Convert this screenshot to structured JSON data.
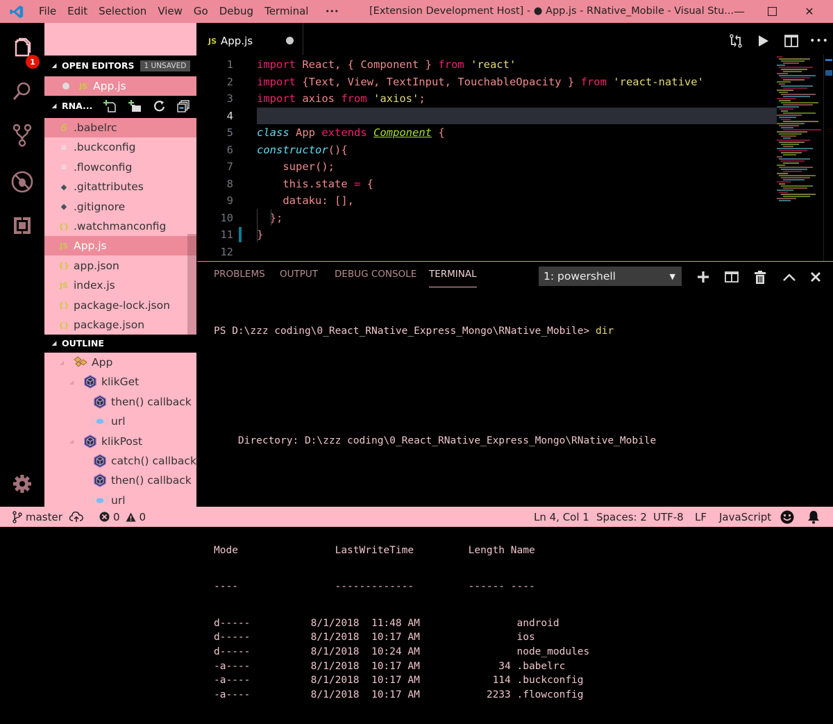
{
  "titlebar": {
    "menu": [
      "File",
      "Edit",
      "Selection",
      "View",
      "Go",
      "Debug",
      "Terminal",
      "•••"
    ],
    "title": "[Extension Development Host] - ● App.js - RNative_Mobile - Visual Stu...",
    "minimize": "—",
    "maximize": "☐",
    "close": "✕"
  },
  "activitybar": {
    "items": [
      "explorer-icon",
      "search-icon",
      "source-control-icon",
      "debug-icon",
      "extensions-icon"
    ],
    "explorer_badge": "1",
    "settings": "gear-icon"
  },
  "sidebar": {
    "open_editors": {
      "label": "OPEN EDITORS",
      "badge": "1 UNSAVED",
      "files": [
        {
          "icon": "JS",
          "name": "App.js",
          "dirty": true
        }
      ]
    },
    "folder": {
      "label": "RNA...",
      "actions": [
        "new-file-icon",
        "new-folder-icon",
        "refresh-icon",
        "collapse-all-icon"
      ],
      "files": [
        {
          "icon": "6",
          "name": ".babelrc",
          "type": "babel"
        },
        {
          "icon": "≡",
          "name": ".buckconfig",
          "type": "config"
        },
        {
          "icon": "≡",
          "name": ".flowconfig",
          "type": "config"
        },
        {
          "icon": "◆",
          "name": ".gitattributes",
          "type": "git"
        },
        {
          "icon": "◆",
          "name": ".gitignore",
          "type": "git"
        },
        {
          "icon": "{}",
          "name": ".watchmanconfig",
          "type": "json"
        },
        {
          "icon": "JS",
          "name": "App.js",
          "type": "js"
        },
        {
          "icon": "{}",
          "name": "app.json",
          "type": "json"
        },
        {
          "icon": "JS",
          "name": "index.js",
          "type": "js"
        },
        {
          "icon": "{}",
          "name": "package-lock.json",
          "type": "json"
        },
        {
          "icon": "{}",
          "name": "package.json",
          "type": "json"
        }
      ]
    },
    "outline": {
      "label": "OUTLINE",
      "items": [
        {
          "name": "App",
          "kind": "class",
          "level": 0,
          "expanded": true
        },
        {
          "name": "klikGet",
          "kind": "method",
          "level": 1,
          "expanded": true
        },
        {
          "name": "then() callback",
          "kind": "method",
          "level": 2
        },
        {
          "name": "url",
          "kind": "variable",
          "level": 2
        },
        {
          "name": "klikPost",
          "kind": "method",
          "level": 1,
          "expanded": true
        },
        {
          "name": "catch() callback",
          "kind": "method",
          "level": 2
        },
        {
          "name": "then() callback",
          "kind": "method",
          "level": 2
        },
        {
          "name": "url",
          "kind": "variable",
          "level": 2
        }
      ]
    }
  },
  "editor": {
    "tab": {
      "icon": "JS",
      "label": "App.js"
    },
    "actions": [
      "open-changes-icon",
      "run-icon",
      "split-editor-icon",
      "more-actions-icon"
    ],
    "current_line": 4,
    "lines": [
      {
        "n": "1",
        "tokens": [
          [
            "kw",
            "import"
          ],
          [
            "id",
            " React, { Component } "
          ],
          [
            "kw",
            "from"
          ],
          [
            "id",
            " "
          ],
          [
            "str",
            "'react'"
          ]
        ]
      },
      {
        "n": "2",
        "tokens": [
          [
            "kw",
            "import"
          ],
          [
            "id",
            " {Text, View, TextInput, TouchableOpacity } "
          ],
          [
            "kw",
            "from"
          ],
          [
            "id",
            " "
          ],
          [
            "str",
            "'react-native'"
          ]
        ]
      },
      {
        "n": "3",
        "tokens": [
          [
            "kw",
            "import"
          ],
          [
            "id",
            " axios "
          ],
          [
            "kw",
            "from"
          ],
          [
            "id",
            " "
          ],
          [
            "str",
            "'axios'"
          ],
          [
            "id",
            ";"
          ]
        ]
      },
      {
        "n": "4",
        "tokens": []
      },
      {
        "n": "5",
        "tokens": [
          [
            "ital",
            "class"
          ],
          [
            "id",
            " App "
          ],
          [
            "kw",
            "extends"
          ],
          [
            "id",
            " "
          ],
          [
            "cls",
            "Component"
          ],
          [
            "id",
            " {"
          ]
        ]
      },
      {
        "n": "6",
        "tokens": [
          [
            "ital",
            "constructor"
          ],
          [
            "id",
            "(){"
          ]
        ]
      },
      {
        "n": "7",
        "tokens": [
          [
            "id",
            "    super();"
          ]
        ]
      },
      {
        "n": "8",
        "tokens": [
          [
            "id",
            "    this.state "
          ],
          [
            "kw",
            "="
          ],
          [
            "id",
            " {"
          ]
        ]
      },
      {
        "n": "9",
        "tokens": [
          [
            "id",
            "    dataku: [],"
          ]
        ]
      },
      {
        "n": "10",
        "tokens": [
          [
            "id",
            "  };"
          ]
        ]
      },
      {
        "n": "11",
        "tokens": [
          [
            "id",
            "}"
          ]
        ]
      },
      {
        "n": "12",
        "tokens": []
      }
    ]
  },
  "panel": {
    "tabs": [
      "PROBLEMS",
      "OUTPUT",
      "DEBUG CONSOLE",
      "TERMINAL"
    ],
    "active_tab": "TERMINAL",
    "terminal_select": "1: powershell",
    "actions": [
      "add-terminal-icon",
      "split-terminal-icon",
      "kill-terminal-icon",
      "maximize-panel-icon",
      "close-panel-icon"
    ],
    "terminal": {
      "prompt": "PS D:\\zzz coding\\0_React_RNative_Express_Mongo\\RNative_Mobile> ",
      "command": "dir",
      "directory_line": "    Directory: D:\\zzz coding\\0_React_RNative_Express_Mongo\\RNative_Mobile",
      "header": "Mode                LastWriteTime         Length Name",
      "underline": "----                -------------         ------ ----",
      "rows": [
        {
          "mode": "d-----",
          "date": "8/1/2018",
          "time": "11:48 AM",
          "length": "",
          "name": "android"
        },
        {
          "mode": "d-----",
          "date": "8/1/2018",
          "time": "10:17 AM",
          "length": "",
          "name": "ios"
        },
        {
          "mode": "d-----",
          "date": "8/1/2018",
          "time": "10:24 AM",
          "length": "",
          "name": "node_modules"
        },
        {
          "mode": "-a----",
          "date": "8/1/2018",
          "time": "10:17 AM",
          "length": "34",
          "name": ".babelrc"
        },
        {
          "mode": "-a----",
          "date": "8/1/2018",
          "time": "10:17 AM",
          "length": "114",
          "name": ".buckconfig"
        },
        {
          "mode": "-a----",
          "date": "8/1/2018",
          "time": "10:17 AM",
          "length": "2233",
          "name": ".flowconfig"
        }
      ]
    }
  },
  "statusbar": {
    "branch": "master",
    "errors": "0",
    "warnings": "0",
    "position": "Ln 4, Col 1",
    "indent": "Spaces: 2",
    "encoding": "UTF-8",
    "eol": "LF",
    "language": "JavaScript"
  }
}
